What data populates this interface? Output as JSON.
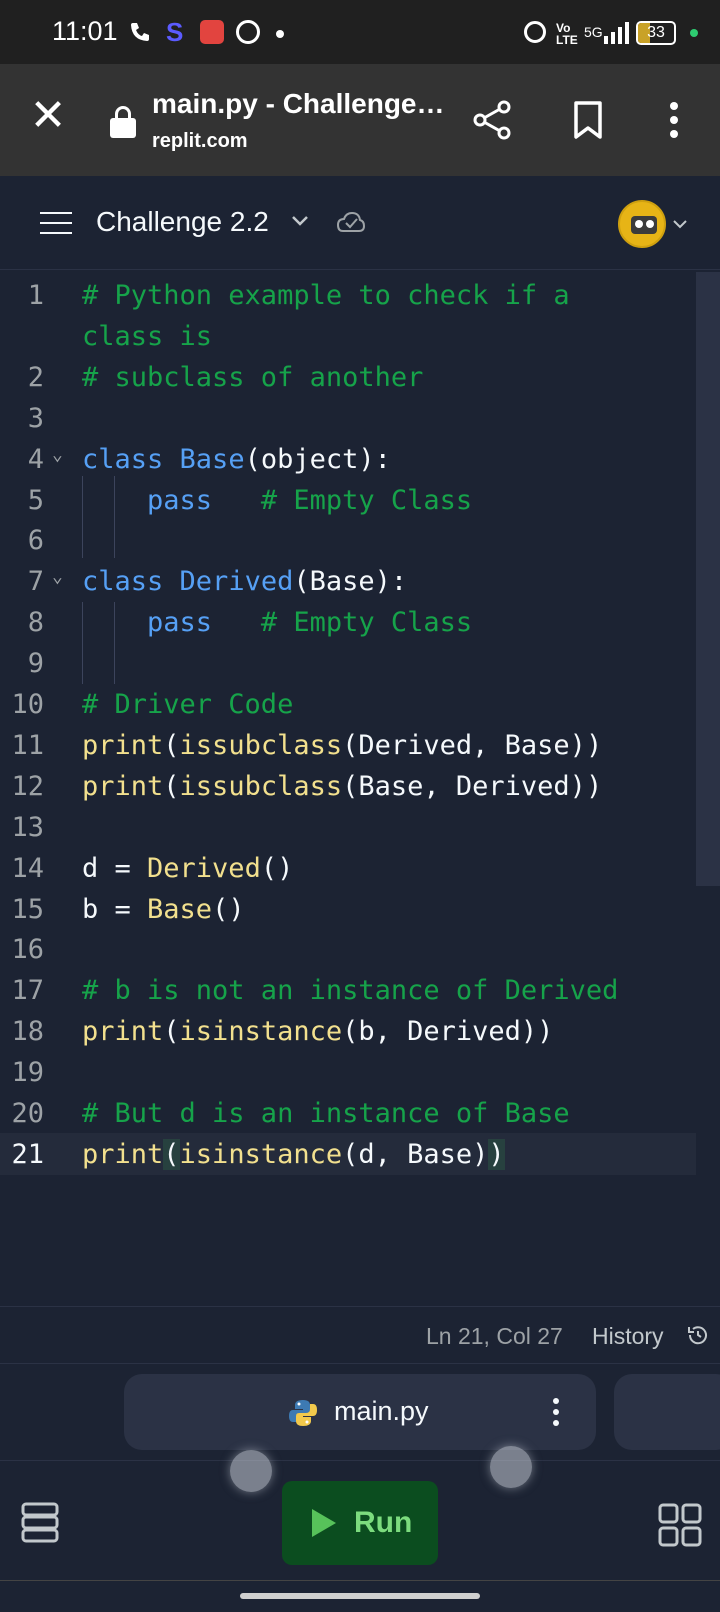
{
  "status_bar": {
    "time": "11:01",
    "s_app": "S",
    "network": "5G",
    "volte": "Vo\nLTE",
    "battery": "33"
  },
  "browser": {
    "title": "main.py - Challenge…",
    "url": "replit.com"
  },
  "workspace": {
    "title": "Challenge 2.2"
  },
  "editor": {
    "lines": [
      {
        "n": "1",
        "parts": [
          {
            "t": "# Python example to check if a",
            "c": "c-com"
          }
        ]
      },
      {
        "n": "",
        "parts": [
          {
            "t": "class is",
            "c": "c-com"
          }
        ]
      },
      {
        "n": "2",
        "parts": [
          {
            "t": "# subclass of another",
            "c": "c-com"
          }
        ]
      },
      {
        "n": "3",
        "parts": []
      },
      {
        "n": "4",
        "fold": true,
        "parts": [
          {
            "t": "class ",
            "c": "c-kw"
          },
          {
            "t": "Base",
            "c": "c-kw"
          },
          {
            "t": "(object):",
            "c": "c-pl"
          }
        ]
      },
      {
        "n": "5",
        "parts": [
          {
            "t": "    pass",
            "c": "c-kw"
          },
          {
            "t": "   # Empty Class",
            "c": "c-com"
          }
        ]
      },
      {
        "n": "6",
        "parts": []
      },
      {
        "n": "7",
        "fold": true,
        "parts": [
          {
            "t": "class ",
            "c": "c-kw"
          },
          {
            "t": "Derived",
            "c": "c-kw"
          },
          {
            "t": "(Base):",
            "c": "c-pl"
          }
        ]
      },
      {
        "n": "8",
        "parts": [
          {
            "t": "    pass",
            "c": "c-kw"
          },
          {
            "t": "   # Empty Class",
            "c": "c-com"
          }
        ]
      },
      {
        "n": "9",
        "parts": []
      },
      {
        "n": "10",
        "parts": [
          {
            "t": "# Driver Code",
            "c": "c-com"
          }
        ]
      },
      {
        "n": "11",
        "parts": [
          {
            "t": "print",
            "c": "c-fn"
          },
          {
            "t": "(",
            "c": "c-pl"
          },
          {
            "t": "issubclass",
            "c": "c-fn"
          },
          {
            "t": "(Derived, Base))",
            "c": "c-pl"
          }
        ]
      },
      {
        "n": "12",
        "parts": [
          {
            "t": "print",
            "c": "c-fn"
          },
          {
            "t": "(",
            "c": "c-pl"
          },
          {
            "t": "issubclass",
            "c": "c-fn"
          },
          {
            "t": "(Base, Derived))",
            "c": "c-pl"
          }
        ]
      },
      {
        "n": "13",
        "parts": []
      },
      {
        "n": "14",
        "parts": [
          {
            "t": "d = ",
            "c": "c-pl"
          },
          {
            "t": "Derived",
            "c": "c-fn"
          },
          {
            "t": "()",
            "c": "c-pl"
          }
        ]
      },
      {
        "n": "15",
        "parts": [
          {
            "t": "b = ",
            "c": "c-pl"
          },
          {
            "t": "Base",
            "c": "c-fn"
          },
          {
            "t": "()",
            "c": "c-pl"
          }
        ]
      },
      {
        "n": "16",
        "parts": []
      },
      {
        "n": "17",
        "parts": [
          {
            "t": "# b is not an instance of Derived",
            "c": "c-com"
          }
        ]
      },
      {
        "n": "18",
        "parts": [
          {
            "t": "print",
            "c": "c-fn"
          },
          {
            "t": "(",
            "c": "c-pl"
          },
          {
            "t": "isinstance",
            "c": "c-fn"
          },
          {
            "t": "(b, Derived))",
            "c": "c-pl"
          }
        ]
      },
      {
        "n": "19",
        "parts": []
      },
      {
        "n": "20",
        "parts": [
          {
            "t": "# But d is an instance of Base",
            "c": "c-com"
          }
        ]
      },
      {
        "n": "21",
        "active": true,
        "parts": [
          {
            "t": "print",
            "c": "c-fn"
          },
          {
            "t": "(",
            "c": "c-pl c-br"
          },
          {
            "t": "isinstance",
            "c": "c-fn"
          },
          {
            "t": "(d, Base)",
            "c": "c-pl"
          },
          {
            "t": ")",
            "c": "c-pl c-br"
          }
        ]
      }
    ]
  },
  "cursor": {
    "position": "Ln 21, Col 27",
    "history_label": "History"
  },
  "tabs": {
    "active_file": "main.py"
  },
  "toolbar": {
    "run_label": "Run"
  },
  "colors": {
    "background": "#1c2333",
    "run_button": "#0b4d1f",
    "comment": "#16a34a",
    "keyword": "#56a0f5",
    "function": "#f2e08e"
  },
  "icons": [
    "phone-icon",
    "record-icon",
    "chrome-icon",
    "alarm-icon",
    "close-icon",
    "lock-icon",
    "share-icon",
    "bookmark-icon",
    "more-icon",
    "menu-icon",
    "chevron-down-icon",
    "check-cloud-icon",
    "avatar",
    "history-icon",
    "python-icon",
    "database-icon",
    "grid-icon"
  ]
}
